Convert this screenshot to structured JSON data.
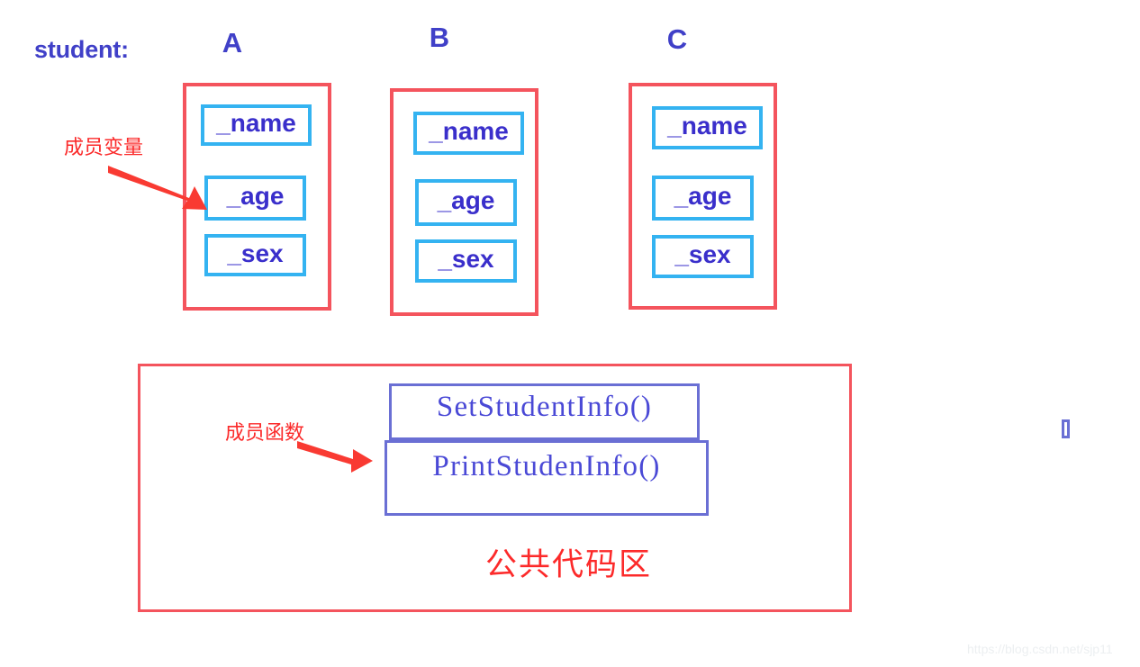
{
  "page": {
    "student_label": "student:",
    "public_area_label": "公共代码区",
    "watermark": "https://blog.csdn.net/sjp11",
    "stray_glyph": "",
    "colors": {
      "object_frame_red": "#f4545d",
      "member_box_cyan": "#34b3f1",
      "member_text_indigo": "#3a2fcb",
      "function_box_periwinkle": "#6a6fd4",
      "function_text_blue": "#4a49d6",
      "annotation_red": "#fb2a2a",
      "title_indigo": "#4040c8",
      "background": "#ffffff"
    }
  },
  "annotations": {
    "member_variables": "成员变量",
    "member_functions": "成员函数"
  },
  "objects": [
    {
      "title": "A",
      "members": [
        {
          "label": "_name"
        },
        {
          "label": "_age"
        },
        {
          "label": "_sex"
        }
      ]
    },
    {
      "title": "B",
      "members": [
        {
          "label": "_name"
        },
        {
          "label": "_age"
        },
        {
          "label": "_sex"
        }
      ]
    },
    {
      "title": "C",
      "members": [
        {
          "label": "_name"
        },
        {
          "label": "_age"
        },
        {
          "label": "_sex"
        }
      ]
    }
  ],
  "functions": [
    {
      "label": "SetStudentInfo()"
    },
    {
      "label": "PrintStudenInfo()"
    }
  ]
}
